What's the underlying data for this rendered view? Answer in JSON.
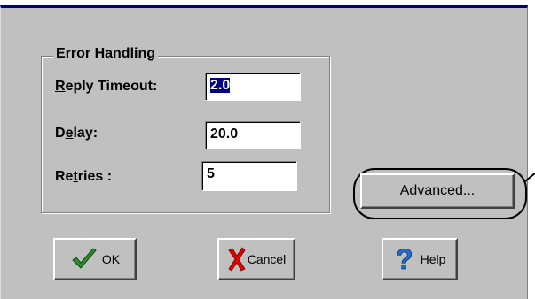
{
  "error_handling": {
    "group_title": "Error Handling",
    "reply_timeout": {
      "label_mnemonic": "R",
      "label_rest": "eply Timeout:",
      "value": "2.0"
    },
    "delay": {
      "label_pre": "D",
      "label_mnemonic": "e",
      "label_rest": "lay:",
      "value": "20.0"
    },
    "retries": {
      "label_pre": "Re",
      "label_mnemonic": "t",
      "label_rest": "ries :",
      "value": "5"
    }
  },
  "advanced_button": {
    "mnemonic": "A",
    "label_rest": "dvanced..."
  },
  "buttons": {
    "ok": {
      "label": "OK",
      "icon": "checkmark-icon"
    },
    "cancel": {
      "label": "Cancel",
      "icon": "x-icon"
    },
    "help": {
      "label": "Help",
      "icon": "question-icon"
    }
  },
  "colors": {
    "dialog_bg": "#c0c0c0",
    "title_bar": "#000080",
    "selection": "#000080",
    "ok_check": "#2e8b2e",
    "cancel_x": "#e00000",
    "help_q": "#1e6fd0"
  }
}
